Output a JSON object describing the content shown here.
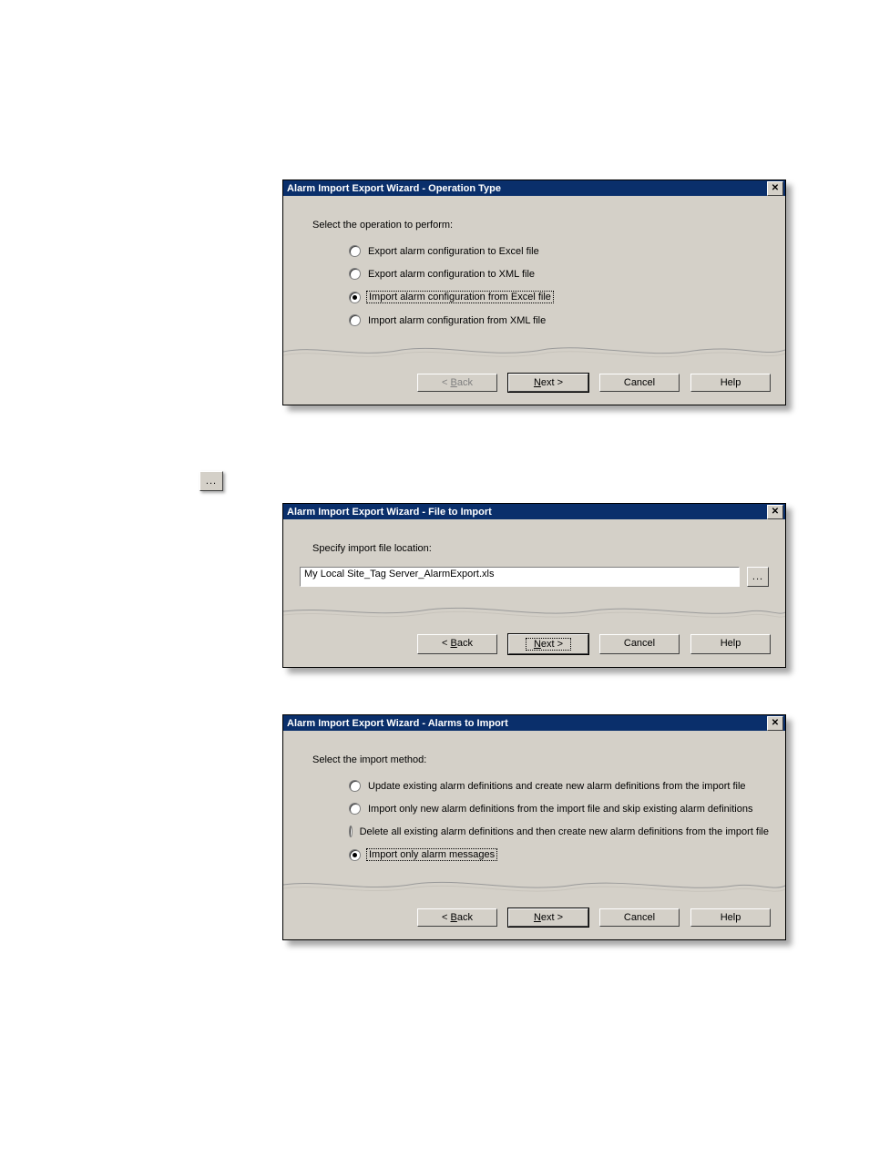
{
  "dialog1": {
    "title": "Alarm Import Export Wizard - Operation Type",
    "close": "✕",
    "prompt": "Select the operation to perform:",
    "options": [
      {
        "label": "Export alarm configuration to Excel file",
        "selected": false
      },
      {
        "label": "Export alarm configuration to XML file",
        "selected": false
      },
      {
        "label": "Import alarm configuration from Excel file",
        "selected": true
      },
      {
        "label": "Import alarm configuration from XML file",
        "selected": false
      }
    ],
    "buttons": {
      "back_prefix": "< ",
      "back_u": "B",
      "back_suffix": "ack",
      "next_u": "N",
      "next_suffix": "ext >",
      "cancel": "Cancel",
      "help": "Help"
    }
  },
  "browse_icon_label": "...",
  "dialog2": {
    "title": "Alarm Import Export Wizard - File to Import",
    "close": "✕",
    "prompt": "Specify import file location:",
    "file_path": "My Local Site_Tag Server_AlarmExport.xls",
    "browse": "...",
    "buttons": {
      "back_prefix": "< ",
      "back_u": "B",
      "back_suffix": "ack",
      "next_u": "N",
      "next_suffix": "ext >",
      "cancel": "Cancel",
      "help": "Help"
    }
  },
  "dialog3": {
    "title": "Alarm Import Export Wizard - Alarms to Import",
    "close": "✕",
    "prompt": "Select the import method:",
    "options": [
      {
        "label": "Update existing alarm definitions and create new alarm definitions from the import file",
        "selected": false
      },
      {
        "label": "Import only new alarm definitions from the import file and skip existing alarm definitions",
        "selected": false
      },
      {
        "label": "Delete all existing alarm definitions and then create new alarm definitions from the import file",
        "selected": false
      },
      {
        "label": "Import only alarm messages",
        "selected": true
      }
    ],
    "buttons": {
      "back_prefix": "< ",
      "back_u": "B",
      "back_suffix": "ack",
      "next_u": "N",
      "next_suffix": "ext >",
      "cancel": "Cancel",
      "help": "Help"
    }
  }
}
